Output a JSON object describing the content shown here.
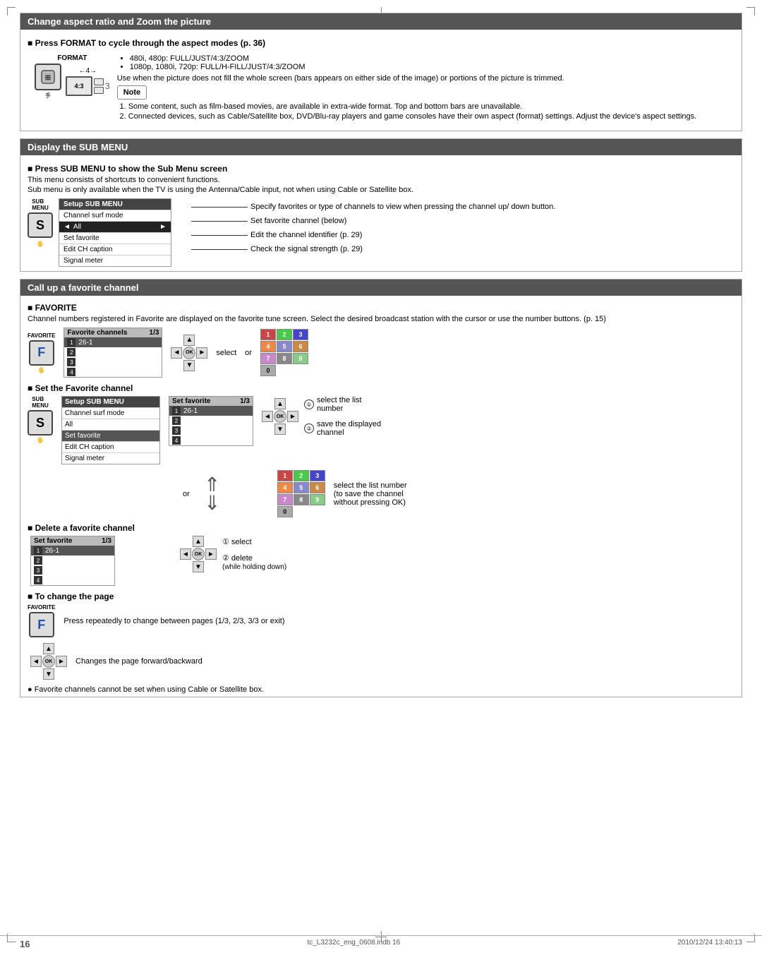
{
  "page": {
    "number": "16",
    "footer_file": "tc_L3232c_eng_0608.indb  16",
    "footer_date": "2010/12/24   13:40:13"
  },
  "sections": {
    "aspect": {
      "title": "Change aspect ratio and Zoom the picture",
      "subsection": "Press FORMAT to cycle through the aspect modes (p. 36)",
      "format_label": "FORMAT",
      "arrow_label": "4",
      "screen_label": "4:3",
      "bullets": [
        "480i, 480p:  FULL/JUST/4:3/ZOOM",
        "1080p, 1080i, 720p:  FULL/H-FILL/JUST/4:3/ZOOM"
      ],
      "use_text": "Use when the picture does not fill the whole screen (bars appears on either side of the image) or portions of the picture is trimmed.",
      "note_label": "Note",
      "notes": [
        "Some content, such as film-based movies, are available in extra-wide format. Top and bottom bars are unavailable.",
        "Connected devices, such as Cable/Satellite box, DVD/Blu-ray players and game consoles have their own aspect (format) settings. Adjust the device's aspect settings."
      ]
    },
    "submenu": {
      "title": "Display the SUB MENU",
      "subsection": "Press SUB MENU to show the Sub Menu screen",
      "desc1": "This menu consists of shortcuts to convenient functions.",
      "desc2": "Sub menu is only available when the TV is using the Antenna/Cable input, not when using Cable or Satellite box.",
      "sub_label": "SUB\nMENU",
      "menu_items": [
        {
          "label": "Setup SUB MENU",
          "header": true
        },
        {
          "label": "Channel surf mode",
          "indent": false
        },
        {
          "label": "All",
          "indent": true,
          "selected": true,
          "arrows": true
        },
        {
          "label": "Set favorite",
          "indent": false
        },
        {
          "label": "Edit CH caption",
          "indent": false
        },
        {
          "label": "Signal meter",
          "indent": false
        }
      ],
      "menu_descs": [
        "Specify favorites or type of channels to view when pressing the channel up/ down button.",
        "Set favorite channel (below)",
        "Edit the channel identifier (p. 29)",
        "Check the signal strength (p. 29)"
      ]
    },
    "favorite": {
      "title": "Call up a favorite channel",
      "subsection_label": "FAVORITE",
      "desc": "Channel numbers registered in Favorite are displayed on the favorite tune screen. Select the desired broadcast station with the cursor or use the number buttons. (p. 15)",
      "fav_label": "FAVORITE",
      "fav_btn_letter": "F",
      "screen_header": "Favorite channels",
      "screen_page": "1/3",
      "channels": [
        {
          "num": "1",
          "val": "26-1"
        },
        {
          "num": "2",
          "val": ""
        },
        {
          "num": "3",
          "val": ""
        },
        {
          "num": "4",
          "val": ""
        }
      ],
      "select_text": "select",
      "or_text": "or",
      "numpad_rows": [
        [
          "1",
          "2",
          "3"
        ],
        [
          "4",
          "5",
          "6"
        ],
        [
          "7",
          "8",
          "9"
        ],
        [
          "0"
        ]
      ],
      "set_fav_title": "Set the Favorite channel",
      "set_fav_steps": [
        "① select the list number",
        "② save the displayed channel"
      ],
      "set_fav_or": "or",
      "set_fav_numpad_note": "select the list number (to save the channel without pressing OK)",
      "delete_title": "Delete a favorite channel",
      "delete_steps": [
        "① select",
        "② delete (while holding down)"
      ],
      "change_page_title": "To change the page",
      "change_page_fav_btn": "F",
      "change_page_desc": "Press repeatedly to change between pages (1/3, 2/3, 3/3 or exit)",
      "change_page_dpad_desc": "Changes the page forward/backward",
      "bullet_note": "Favorite channels cannot be set when using Cable or Satellite box."
    }
  }
}
